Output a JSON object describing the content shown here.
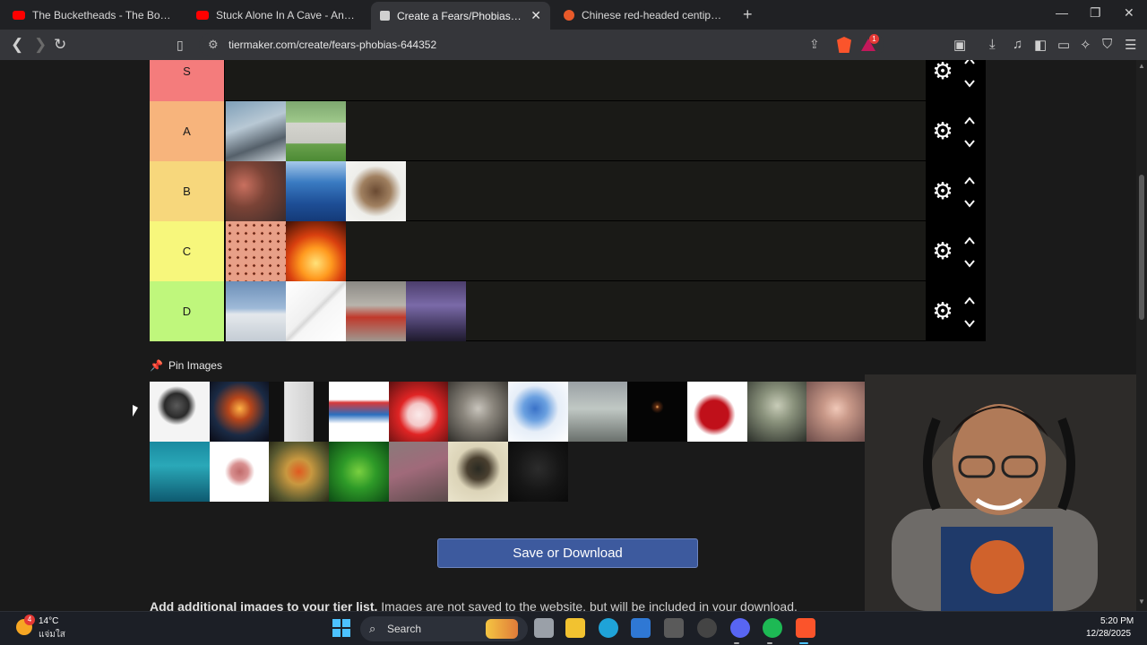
{
  "browser": {
    "tabs": [
      {
        "title": "The Bucketheads - The Bomb [These",
        "favicon": "youtube-icon"
      },
      {
        "title": "Stuck Alone In A Cave - Anxiety Warr",
        "favicon": "youtube-icon"
      },
      {
        "title": "Create a Fears/Phobias Tier List -",
        "favicon": "tiermaker-icon",
        "active": true
      },
      {
        "title": "Chinese red-headed centipede - Brav",
        "favicon": "brave-icon"
      }
    ],
    "url": "tiermaker.com/create/fears-phobias-644352",
    "rewards_badge": "1"
  },
  "tiers": [
    {
      "label": "S",
      "color": "#f47c7c",
      "items": []
    },
    {
      "label": "A",
      "color": "#f7b47c",
      "items": [
        "shark",
        "gravestone"
      ]
    },
    {
      "label": "B",
      "color": "#f7d77c",
      "items": [
        "crowd",
        "ocean",
        "tarantula"
      ]
    },
    {
      "label": "C",
      "color": "#f7f77c",
      "items": [
        "holes",
        "fire"
      ]
    },
    {
      "label": "D",
      "color": "#bff77c",
      "items": [
        "airplane",
        "syringe",
        "puppet",
        "lightning"
      ]
    }
  ],
  "pin_images_label": "Pin Images",
  "pool_items": [
    "microphone",
    "planet-collision",
    "window-silhouette",
    "knot-rope",
    "clown",
    "ted-bundy",
    "virus",
    "heights",
    "dark-candle",
    "blood",
    "alien",
    "scared-child",
    "cockroach",
    "sea-creature",
    "worm",
    "lizard",
    "green-snake",
    "centipede",
    "scorpion",
    "darkness"
  ],
  "save_button": "Save or Download",
  "additional_text_bold": "Add additional images to your tier list.",
  "additional_text_rest": " Images are not saved to the website, but will be included in your download.",
  "taskbar": {
    "weather_temp": "14°C",
    "weather_desc": "แจ่มใส",
    "weather_badge": "4",
    "search": "Search",
    "time": "5:20 PM",
    "date": "12/28/2025"
  },
  "colors": {
    "accent": "#3d5a9e",
    "page_bg": "#1a1a1a"
  }
}
